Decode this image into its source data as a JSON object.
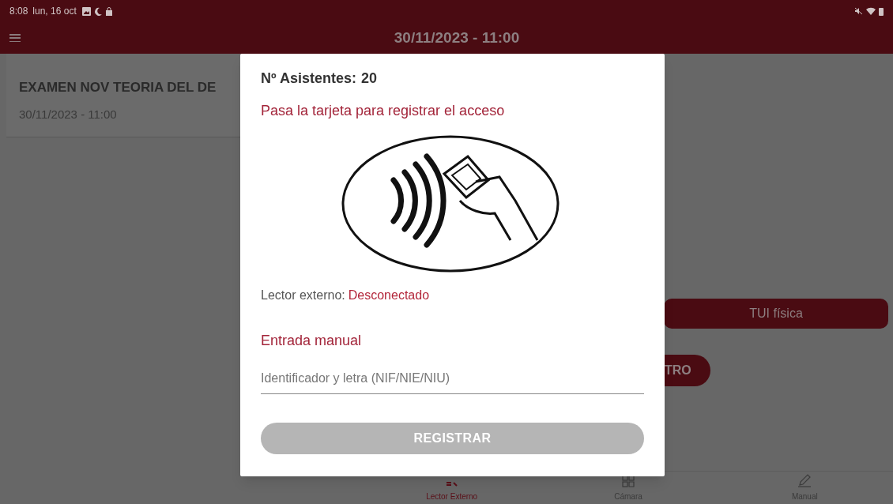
{
  "status_bar": {
    "time": "8:08",
    "date": "lun, 16 oct"
  },
  "app_bar": {
    "title": "30/11/2023 - 11:00"
  },
  "exam": {
    "title": "EXAMEN NOV TEORIA DEL DE",
    "date": "30/11/2023 - 11:00"
  },
  "tui_button": {
    "label": "TUI física"
  },
  "register_button": {
    "label": "TRO"
  },
  "dialog": {
    "attendees_label": "Nº Asistentes:",
    "attendees_count": "20",
    "instruction": "Pasa la tarjeta para registrar el acceso",
    "reader_label": "Lector externo:",
    "reader_status": "Desconectado",
    "manual_title": "Entrada manual",
    "id_field": {
      "placeholder": "Identificador y letra (NIF/NIE/NIU)"
    },
    "submit": {
      "label": "REGISTRAR",
      "disabled": true
    }
  },
  "bottom_nav": [
    {
      "kind": "reader",
      "label": "Lector Externo",
      "selected": true
    },
    {
      "kind": "camera",
      "label": "Cámara",
      "selected": false
    },
    {
      "kind": "manual",
      "label": "Manual",
      "selected": false
    }
  ]
}
